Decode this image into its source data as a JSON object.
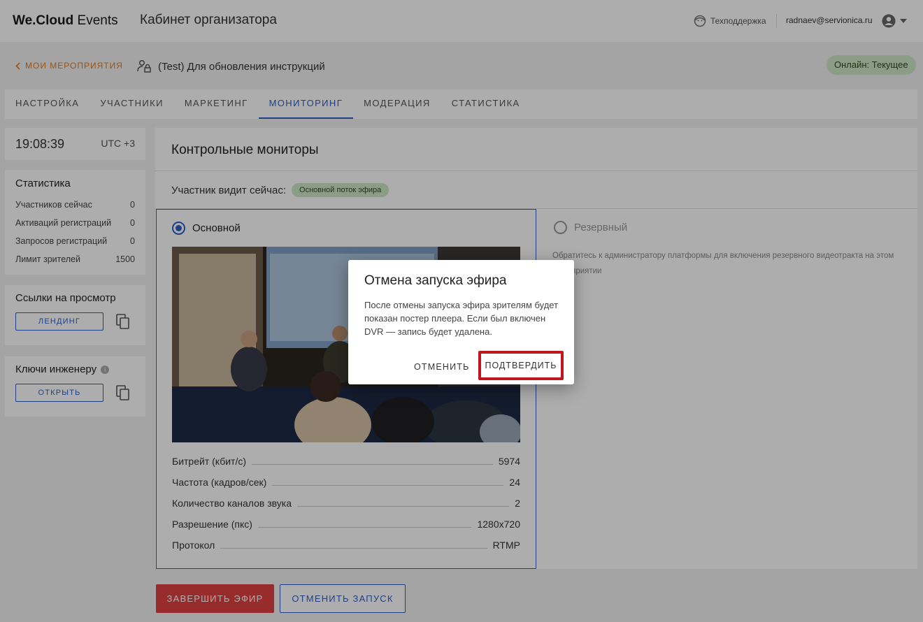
{
  "header": {
    "brand_bold": "We.Cloud",
    "brand_light": "Events",
    "cabinet_title": "Кабинет организатора",
    "support_label": "Техподдержка",
    "user_email": "radnaev@servionica.ru"
  },
  "breadcrumb": {
    "back_label": "МОИ МЕРОПРИЯТИЯ",
    "event_title": "(Test) Для обновления инструкций",
    "online_badge": "Онлайн: Текущее"
  },
  "tabs": [
    {
      "label": "НАСТРОЙКА"
    },
    {
      "label": "УЧАСТНИКИ"
    },
    {
      "label": "МАРКЕТИНГ"
    },
    {
      "label": "МОНИТОРИНГ"
    },
    {
      "label": "МОДЕРАЦИЯ"
    },
    {
      "label": "СТАТИСТИКА"
    }
  ],
  "sidebar": {
    "time": "19:08:39",
    "timezone": "UTC +3",
    "stats_title": "Статистика",
    "stats": [
      {
        "label": "Участников сейчас",
        "value": "0"
      },
      {
        "label": "Активаций регистраций",
        "value": "0"
      },
      {
        "label": "Запросов регистраций",
        "value": "0"
      },
      {
        "label": "Лимит зрителей",
        "value": "1500"
      }
    ],
    "links_title": "Ссылки на просмотр",
    "landing_button": "ЛЕНДИНГ",
    "keys_title": "Ключи инженеру",
    "open_button": "ОТКРЫТЬ"
  },
  "main": {
    "title": "Контрольные мониторы",
    "viewer_label": "Участник видит сейчас:",
    "viewer_chip": "Основной поток эфира",
    "primary_label": "Основной",
    "reserve_label": "Резервный",
    "reserve_note": "Обратитесь к администратору платформы для включения резервного видеотракта на этом мероприятии",
    "metrics": [
      {
        "label": "Битрейт (кбит/с)",
        "value": "5974"
      },
      {
        "label": "Частота (кадров/сек)",
        "value": "24"
      },
      {
        "label": "Количество каналов звука",
        "value": "2"
      },
      {
        "label": "Разрешение (пкс)",
        "value": "1280x720"
      },
      {
        "label": "Протокол",
        "value": "RTMP"
      }
    ]
  },
  "actions": {
    "end_stream": "ЗАВЕРШИТЬ ЭФИР",
    "cancel_launch": "ОТМЕНИТЬ ЗАПУСК"
  },
  "dialog": {
    "title": "Отмена запуска эфира",
    "text": "После отмены запуска эфира зрителям будет показан постер плеера. Если был включен DVR — запись будет удалена.",
    "cancel": "ОТМЕНИТЬ",
    "confirm": "ПОДТВЕРДИТЬ"
  },
  "colors": {
    "accent": "#2f5fc8",
    "danger": "#e04141",
    "back_link": "#e07b1f",
    "online_bg": "#cfe8c7",
    "highlight_box": "#c0161d"
  },
  "icons": [
    "back-chevron-icon",
    "support-face-icon",
    "user-account-icon",
    "chevron-down-icon",
    "event-lock-user-icon",
    "copy-icon",
    "info-icon"
  ]
}
